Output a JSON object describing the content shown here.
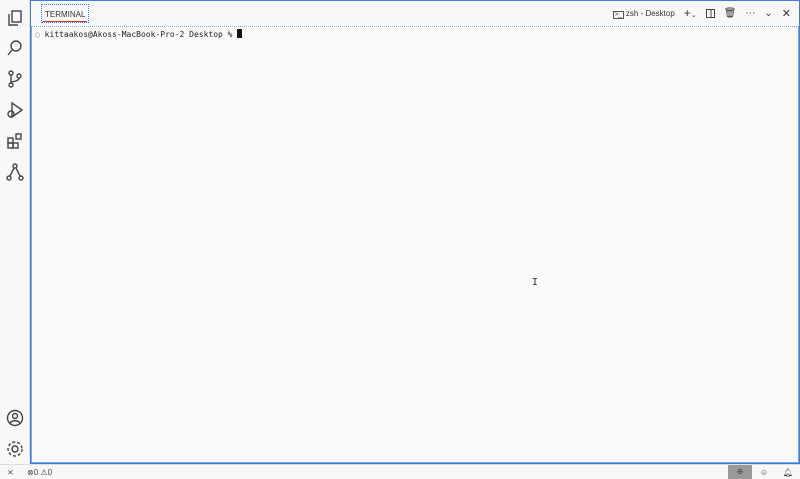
{
  "panel": {
    "tab_label": "TERMINAL",
    "terminal_name": "zsh - Desktop"
  },
  "terminal": {
    "prompt": "kittaakos@Akoss-MacBook-Pro-2 Desktop %"
  },
  "status": {
    "errors": "0",
    "warnings": "0"
  }
}
